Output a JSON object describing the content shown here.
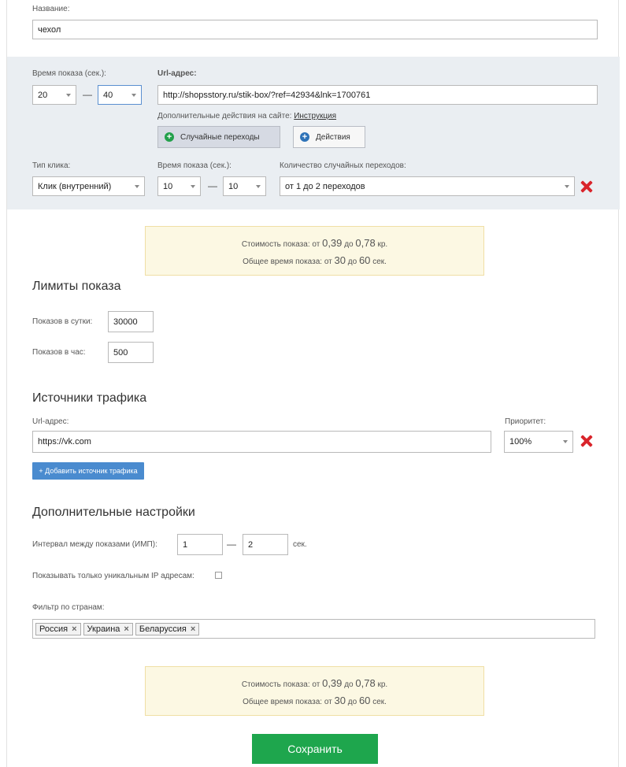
{
  "name_field": {
    "label": "Название:",
    "value": "чехол"
  },
  "transition": {
    "time_label": "Время показа (сек.):",
    "time_from": "20",
    "time_to": "40",
    "dash": "—",
    "url_label": "Url-адрес:",
    "url_value": "http://shopsstory.ru/stik-box/?ref=42934&lnk=1700761",
    "extra_actions_label": "Дополнительные действия на сайте:",
    "instruction_link": "Инструкция",
    "random_button": "Случайные переходы",
    "actions_button": "Действия",
    "click_type_label": "Тип клика:",
    "click_type_value": "Клик (внутренний)",
    "time2_label": "Время показа (сек.):",
    "time2_from": "10",
    "time2_to": "10",
    "count_label": "Количество случайных переходов:",
    "count_value": "от 1 до 2 переходов"
  },
  "cost_box_1": {
    "line1_prefix": "Стоимость показа: от",
    "cost_from": "0,39",
    "to": "до",
    "cost_to": "0,78",
    "cost_unit": "кр.",
    "line2_prefix": "Общее время показа: от",
    "time_from": "30",
    "time_to": "60",
    "time_unit": "сек."
  },
  "limits": {
    "title": "Лимиты показа",
    "per_day_label": "Показов в сутки:",
    "per_day_value": "30000",
    "per_hour_label": "Показов в час:",
    "per_hour_value": "500"
  },
  "traffic": {
    "title": "Источники трафика",
    "url_label": "Url-адрес:",
    "url_value": "https://vk.com",
    "priority_label": "Приоритет:",
    "priority_value": "100%",
    "add_button": "+ Добавить источник трафика"
  },
  "extra": {
    "title": "Дополнительные настройки",
    "interval_label": "Интервал между показами (ИМП):",
    "interval_from": "1",
    "interval_to": "2",
    "dash": "—",
    "interval_unit": "сек.",
    "unique_ip_label": "Показывать только уникальным IP адресам:",
    "country_filter_label": "Фильтр по странам:",
    "countries": [
      "Россия",
      "Украина",
      "Беларуссия"
    ]
  },
  "cost_box_2": {
    "line1_prefix": "Стоимость показа: от",
    "cost_from": "0,39",
    "to": "до",
    "cost_to": "0,78",
    "cost_unit": "кр.",
    "line2_prefix": "Общее время показа: от",
    "time_from": "30",
    "time_to": "60",
    "time_unit": "сек."
  },
  "save_button": "Сохранить",
  "colors": {
    "accent_green": "#1ea64d",
    "accent_blue": "#4a8bcf",
    "delete_red": "#d9242b",
    "notice_bg": "#fcf8e3",
    "band_bg": "#eaeef2"
  }
}
